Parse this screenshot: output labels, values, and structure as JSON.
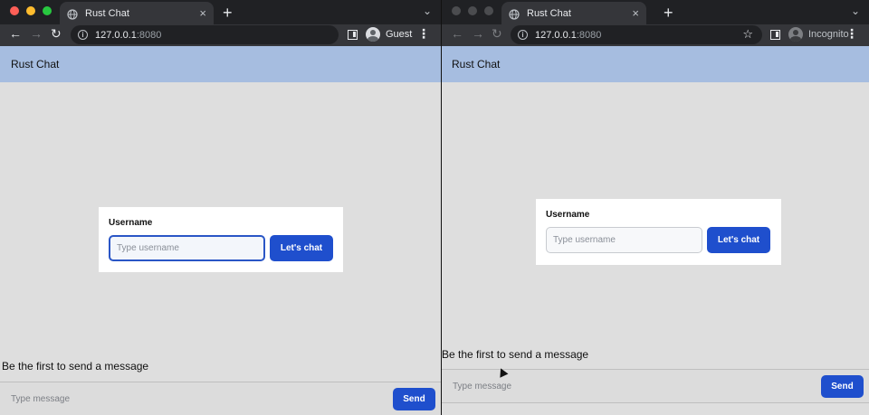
{
  "colors": {
    "tabbar": "#202124",
    "toolbar": "#35363a",
    "app_header": "#a6bde0",
    "app_bg": "#dedede",
    "primary": "#1f4fcd",
    "traffic_close": "#ff5f57",
    "traffic_min": "#febc2e",
    "traffic_max": "#28c840",
    "traffic_inactive": "#4b4c4f"
  },
  "windows": [
    {
      "tab_title": "Rust Chat",
      "url_host": "127.0.0.1",
      "url_port": ":8080",
      "profile_label": "Guest",
      "app_title": "Rust Chat",
      "username_label": "Username",
      "username_placeholder": "Type username",
      "username_focused": true,
      "submit_label": "Let's chat",
      "empty_state": "Be the first to send a message",
      "message_placeholder": "Type message",
      "send_label": "Send"
    },
    {
      "tab_title": "Rust Chat",
      "url_host": "127.0.0.1",
      "url_port": ":8080",
      "profile_label": "Incognito",
      "app_title": "Rust Chat",
      "username_label": "Username",
      "username_placeholder": "Type username",
      "username_focused": false,
      "submit_label": "Let's chat",
      "empty_state": "Be the first to send a message",
      "message_placeholder": "Type message",
      "send_label": "Send"
    }
  ],
  "icons": {
    "new_tab": "+",
    "close": "×",
    "back": "←",
    "forward": "→",
    "reload": "↻",
    "star": "☆",
    "tab_menu": "⌄",
    "menu": "⋮",
    "info": "i"
  }
}
